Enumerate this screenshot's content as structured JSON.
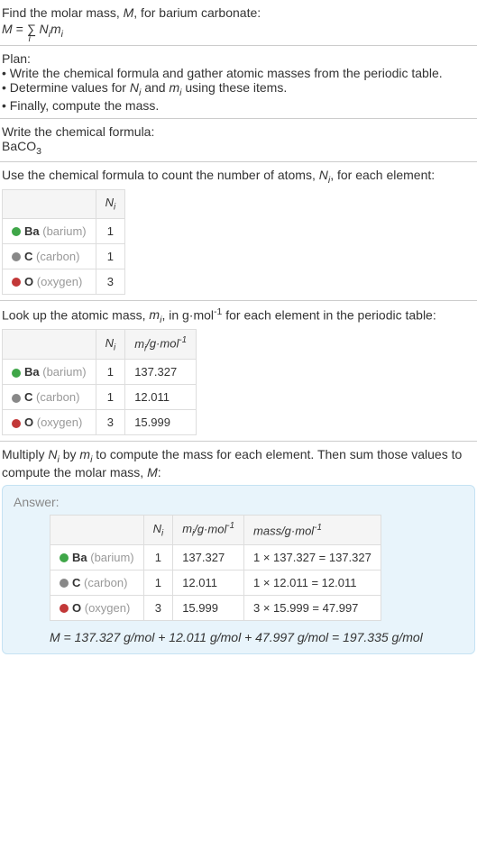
{
  "intro": {
    "line1": "Find the molar mass, ",
    "line1_var": "M",
    "line1_end": ", for barium carbonate:",
    "formula_prefix": "M = ",
    "formula_sum": "∑",
    "formula_sub": "i",
    "formula_body": " N",
    "formula_body2": "m"
  },
  "plan": {
    "header": "Plan:",
    "bullet1": "• Write the chemical formula and gather atomic masses from the periodic table.",
    "bullet2_a": "• Determine values for ",
    "bullet2_b": " and ",
    "bullet2_c": " using these items.",
    "bullet3": "• Finally, compute the mass."
  },
  "chemFormula": {
    "header": "Write the chemical formula:",
    "formula": "BaCO",
    "formula_sub": "3"
  },
  "countAtoms": {
    "header_a": "Use the chemical formula to count the number of atoms, ",
    "header_b": ", for each element:",
    "col_ni": "N",
    "col_ni_sub": "i",
    "rows": [
      {
        "dot": "dot-ba",
        "symbol": "Ba",
        "name": " (barium)",
        "ni": "1"
      },
      {
        "dot": "dot-c",
        "symbol": "C",
        "name": " (carbon)",
        "ni": "1"
      },
      {
        "dot": "dot-o",
        "symbol": "O",
        "name": " (oxygen)",
        "ni": "3"
      }
    ]
  },
  "atomicMass": {
    "header_a": "Look up the atomic mass, ",
    "header_b": ", in g·mol",
    "header_c": " for each element in the periodic table:",
    "col_mi_unit": "/g·mol",
    "rows": [
      {
        "dot": "dot-ba",
        "symbol": "Ba",
        "name": " (barium)",
        "ni": "1",
        "mi": "137.327"
      },
      {
        "dot": "dot-c",
        "symbol": "C",
        "name": " (carbon)",
        "ni": "1",
        "mi": "12.011"
      },
      {
        "dot": "dot-o",
        "symbol": "O",
        "name": " (oxygen)",
        "ni": "3",
        "mi": "15.999"
      }
    ]
  },
  "compute": {
    "header_a": "Multiply ",
    "header_b": " by ",
    "header_c": " to compute the mass for each element. Then sum those values to compute the molar mass, ",
    "header_d": ":"
  },
  "answer": {
    "label": "Answer:",
    "col_mass": "mass/g·mol",
    "rows": [
      {
        "dot": "dot-ba",
        "symbol": "Ba",
        "name": " (barium)",
        "ni": "1",
        "mi": "137.327",
        "mass": "1 × 137.327 = 137.327"
      },
      {
        "dot": "dot-c",
        "symbol": "C",
        "name": " (carbon)",
        "ni": "1",
        "mi": "12.011",
        "mass": "1 × 12.011 = 12.011"
      },
      {
        "dot": "dot-o",
        "symbol": "O",
        "name": " (oxygen)",
        "ni": "3",
        "mi": "15.999",
        "mass": "3 × 15.999 = 47.997"
      }
    ],
    "final": "M = 137.327 g/mol + 12.011 g/mol + 47.997 g/mol = 197.335 g/mol"
  }
}
